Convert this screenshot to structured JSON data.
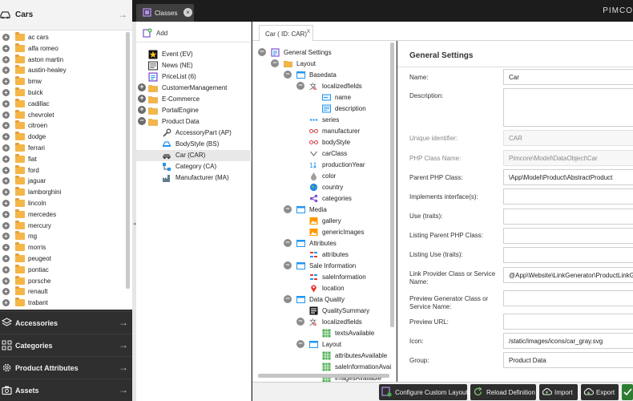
{
  "sidebar": {
    "title": "Cars",
    "folders": [
      "ac cars",
      "alfa romeo",
      "aston martin",
      "austin-healey",
      "bmw",
      "buick",
      "cadillac",
      "chevrolet",
      "citroen",
      "dodge",
      "ferrari",
      "fiat",
      "ford",
      "jaguar",
      "lamborghini",
      "lincoln",
      "mercedes",
      "mercury",
      "mg",
      "morris",
      "peugeot",
      "pontiac",
      "porsche",
      "renault",
      "trabant"
    ],
    "nav": [
      "Accessories",
      "Categories",
      "Product Attributes",
      "Assets"
    ]
  },
  "topbar": {
    "tab_label": "Classes",
    "brand": "PIMCO"
  },
  "class_tree": {
    "add_label": "Add",
    "items": [
      "Event (EV)",
      "News (NE)",
      "PriceList (6)",
      "CustomerManagement",
      "E-Commerce",
      "PortalEngine",
      "Product Data",
      "AccessoryPart (AP)",
      "BodyStyle (BS)",
      "Car (CAR)",
      "Category (CA)",
      "Manufacturer (MA)"
    ]
  },
  "editor": {
    "tab_label": "Car ( ID: CAR)",
    "tab_close": "x"
  },
  "layout_tree": {
    "items": [
      "General Settings",
      "Layout",
      "Basedata",
      "localizedfields",
      "name",
      "description",
      "series",
      "manufacturer",
      "bodyStyle",
      "carClass",
      "productionYear",
      "color",
      "country",
      "categories",
      "Media",
      "gallery",
      "genericImages",
      "Attributes",
      "attributes",
      "Sale Information",
      "saleInformation",
      "location",
      "Data Quality",
      "QualitySummary",
      "localizedfields",
      "textsAvailable",
      "Layout",
      "attributesAvailable",
      "saleInformationAvai",
      "imagesAvailable"
    ]
  },
  "settings": {
    "title": "General Settings",
    "fields": [
      {
        "label": "Name:",
        "value": ""
      },
      {
        "label": "Description:",
        "value": ""
      },
      {
        "label": "Unique identifier:",
        "value": "CAR"
      },
      {
        "label": "PHP Class Name:",
        "value": "Pimcore\\Model\\DataObject\\Car"
      },
      {
        "label": "Parent PHP Class:",
        "value": "\\App\\Model\\Product\\AbstractProduct"
      },
      {
        "label": "Implements interface(s):",
        "value": ""
      },
      {
        "label": "Use (traits):",
        "value": ""
      },
      {
        "label": "Listing Parent PHP Class:",
        "value": ""
      },
      {
        "label": "Listing Use (traits):",
        "value": ""
      },
      {
        "label": "Link Provider Class or Service Name:",
        "value": "@App\\Website\\LinkGenerator\\ProductLinkG"
      },
      {
        "label": "Preview Generator Class or Service Name:",
        "value": ""
      },
      {
        "label": "Preview URL:",
        "value": ""
      },
      {
        "label": "Icon:",
        "value": "/static/images/icons/car_gray.svg"
      },
      {
        "label": "Group:",
        "value": "Product Data"
      }
    ],
    "name_value": "Car"
  },
  "buttons": {
    "custom_layouts": "Configure Custom Layouts",
    "reload": "Reload Definition",
    "import": "Import",
    "export": "Export"
  }
}
